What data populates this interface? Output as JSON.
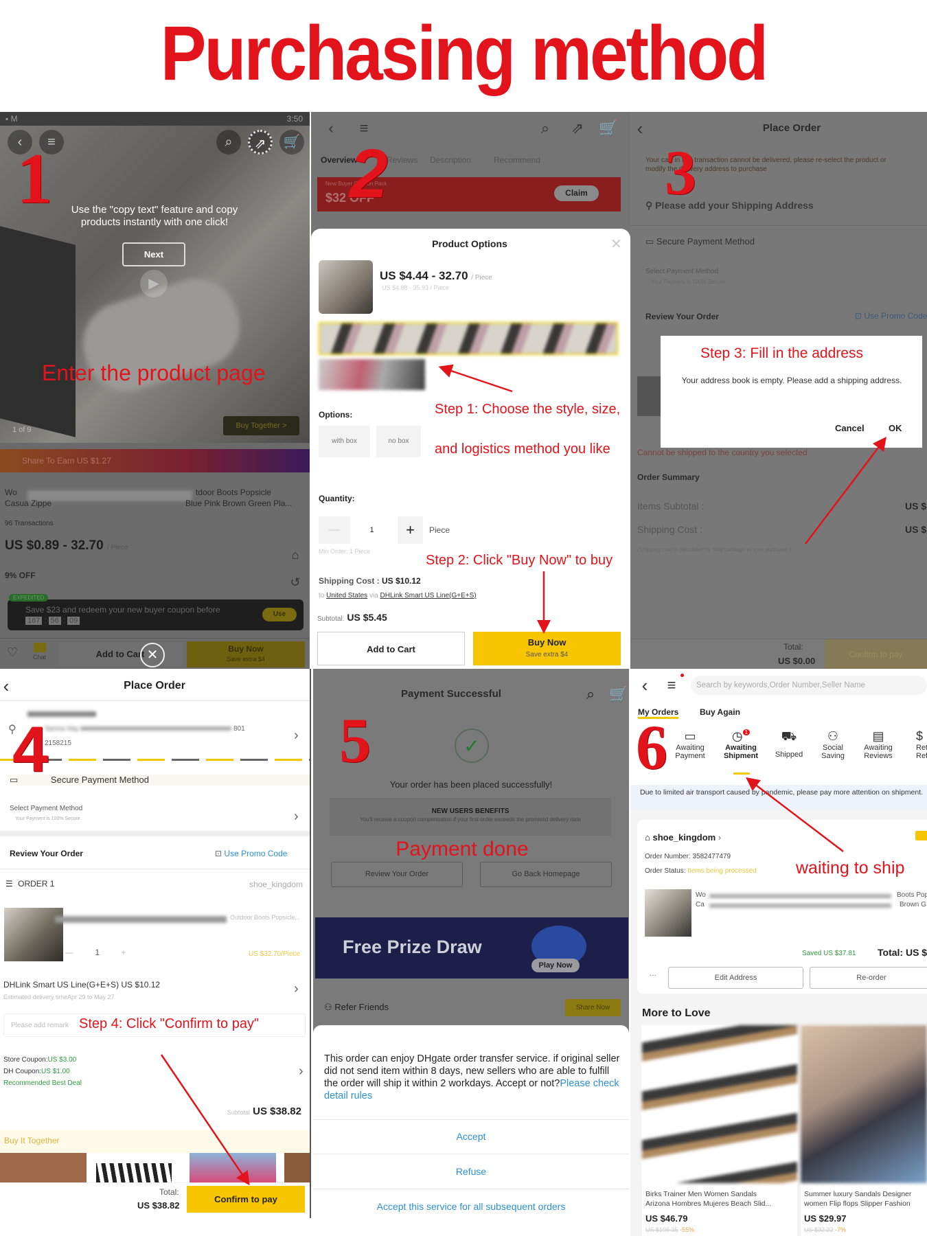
{
  "title": "Purchasing method",
  "colors": {
    "accent_red": "#e3131b",
    "dhgate_yellow": "#f7c600",
    "link_blue": "#2a8fd6",
    "success_green": "#2e9a3e",
    "coupon_red": "#a3191b"
  },
  "step1": {
    "number": "1",
    "status_time": "3:50",
    "tooltip_line1": "Use the \"copy text\" feature and copy",
    "tooltip_line2": "products instantly with one click!",
    "next": "Next",
    "annotation": "Enter the product page",
    "image_counter": "1 of 9",
    "buy_together": "Buy Together >",
    "share_to_earn": "Share To Earn US $1.27",
    "title_line1_start": "Wo",
    "title_line1_end": "tdoor Boots Popsicle",
    "title_line2_start": "Casua Zippe",
    "title_line2_end": "Blue Pink Brown Green Pla...",
    "transactions": "96 Transactions",
    "price": "US $0.89 - 32.70",
    "price_unit": "/ Piece",
    "discount": "9% OFF",
    "expedited": "EXPEDITED",
    "coupon_text": "Save $23 and redeem your new buyer coupon before",
    "timer": [
      "167",
      "56",
      "09"
    ],
    "use": "Use",
    "chat": "Chat",
    "add_to_cart": "Add to Cart",
    "buy_now": "Buy Now",
    "buy_now_sub": "Save extra $4"
  },
  "step2": {
    "number": "2",
    "tabs": [
      "Overview",
      "Reviews",
      "Description",
      "Recommend"
    ],
    "coupon_label": "New Buyer Coupon Pack",
    "coupon_amount": "$32 OFF",
    "claim": "Claim",
    "modal_title": "Product Options",
    "price": "US $4.44 - 32.70",
    "price_unit": "/ Piece",
    "old_price": "US $4.88 - 35.93 / Piece",
    "options_label": "Options:",
    "options": [
      "with box",
      "no box"
    ],
    "quantity_label": "Quantity:",
    "quantity": "1",
    "quantity_unit": "Piece",
    "min_order": "Min Order: 1 Piece",
    "shipping_label": "Shipping Cost :",
    "shipping_value": "US $10.12",
    "to": "to",
    "country": "United States",
    "via": "via",
    "method": "DHLink Smart US Line(G+E+S)",
    "subtotal_label": "Subtotal:",
    "subtotal": "US $5.45",
    "add_to_cart": "Add to Cart",
    "buy_now": "Buy Now",
    "buy_now_sub": "Save extra $4",
    "annotation1_line1": "Step 1: Choose the style, size,",
    "annotation1_line2": "and logistics method you like",
    "annotation2": "Step 2: Click \"Buy Now\" to buy"
  },
  "step3": {
    "number": "3",
    "header": "Place Order",
    "warning_line1": "Your cart in this transaction cannot be delivered, please re-select the product or",
    "warning_line2": "modify the delivery address to purchase",
    "add_address": "Please add your Shipping Address",
    "secure_payment": "Secure Payment Method",
    "select_payment": "Select Payment Method",
    "secure_note": "Your Payment is 100% Secure",
    "review_order": "Review Your Order",
    "promo": "Use Promo Code",
    "dialog_title": "Step 3: Fill in the address",
    "dialog_text": "Your address book is empty. Please add a shipping address.",
    "cancel": "Cancel",
    "ok": "OK",
    "cannot_ship": "Cannot be shipped to the country you selected",
    "order_summary": "Order Summary",
    "items_subtotal": "Items Subtotal :",
    "shipping_cost": "Shipping Cost :",
    "summary_value": "US $",
    "shipping_note": "(Shipping cost is calculated by total package of your purchase.)",
    "total_label": "Total:",
    "total": "US $0.00",
    "confirm": "Confirm to pay"
  },
  "step4": {
    "number": "4",
    "header": "Place Order",
    "address_name": "Sanna Hay",
    "address_suffix": "801",
    "phone": "2158215",
    "secure_payment": "Secure Payment Method",
    "select_payment": "Select Payment Method",
    "secure_note": "Your Payment is 100% Secure",
    "review_order": "Review Your Order",
    "promo": "Use Promo Code",
    "order_label": "ORDER 1",
    "store": "shoe_kingdom",
    "product_title": "Outdoor Boots Popsicle...",
    "quantity": "1",
    "unit_price": "US $32.70/Piece",
    "shipping_method": "DHLink Smart US Line(G+E+S) US $10.12",
    "delivery": "Estimated delivery timeApr 29 to May 27",
    "remark_placeholder": "Please add remark",
    "annotation": "Step 4: Click \"Confirm to pay\"",
    "store_coupon_label": "Store Coupon:",
    "store_coupon": "US $3.00",
    "dh_coupon_label": "DH Coupon:",
    "dh_coupon": "US $1.00",
    "best_deal": "Recommended Best Deal",
    "subtotal_label": "Subtotal",
    "subtotal": "US $38.82",
    "buy_together": "Buy It Together",
    "total_label": "Total:",
    "total": "US $38.82",
    "confirm": "Confirm to pay"
  },
  "step5": {
    "number": "5",
    "header": "Payment Successful",
    "placed": "Your order has been placed successfully!",
    "benefits_title": "NEW USERS BENEFITS",
    "benefits_text": "You'll receive a coupon compensation if your first order exceeds the promised delivery date",
    "annotation": "Payment done",
    "review_order": "Review Your Order",
    "go_home": "Go Back Homepage",
    "banner": "Free Prize Draw",
    "play_now": "Play Now",
    "refer": "Refer Friends",
    "share_now": "Share Now",
    "modal_text": "This order can enjoy DHgate order transfer service. if original seller did not send item within 8 days, new sellers who are able to fulfill the order will ship it within 2 workdays. Accept or not?",
    "modal_link": "Please check detail rules",
    "accept": "Accept",
    "refuse": "Refuse",
    "accept_all": "Accept this service for all subsequent orders"
  },
  "step6": {
    "number": "6",
    "search_placeholder": "Search by keywords,Order Number,Seller Name",
    "tabs": [
      "My Orders",
      "Buy Again"
    ],
    "statuses": [
      {
        "line1": "Awaiting",
        "line2": "Payment",
        "icon": "card-icon"
      },
      {
        "line1": "Awaiting",
        "line2": "Shipment",
        "icon": "clock-icon",
        "badge": "1"
      },
      {
        "line1": "Shipped",
        "line2": "",
        "icon": "truck-icon"
      },
      {
        "line1": "Social",
        "line2": "Saving",
        "icon": "people-icon"
      },
      {
        "line1": "Awaiting",
        "line2": "Reviews",
        "icon": "review-icon"
      },
      {
        "line1": "Retu",
        "line2": "Refu",
        "icon": "refund-icon"
      }
    ],
    "notice": "Due to limited air transport caused by pandemic, please pay more attention on shipment.",
    "store": "shoe_kingdom",
    "order_number": "Order Number: 3582477479",
    "status_label": "Order Status:",
    "status_value": "Items being processed",
    "annotation": "waiting to ship",
    "product_line1_start": "Wo",
    "product_line1_end": "Boots Pop",
    "product_line2_start": "Ca",
    "product_line2_end": "Brown G",
    "saved": "Saved US $37.81",
    "total": "Total: US $5",
    "more": "...",
    "edit_address": "Edit Address",
    "reorder": "Re-order",
    "more_to_love": "More to Love",
    "products": [
      {
        "title_line1": "Birks Trainer Men Women Sandals",
        "title_line2": "Arizona Hombres Mujeres Beach Slid...",
        "price": "US $46.79",
        "old_price": "US $106.35",
        "discount": "-55%"
      },
      {
        "title_line1": "Summer luxury Sandals Designer",
        "title_line2": "women Flip flops Slipper Fashion",
        "price": "US $29.97",
        "old_price": "US $32.22",
        "discount": "-7%"
      }
    ]
  }
}
